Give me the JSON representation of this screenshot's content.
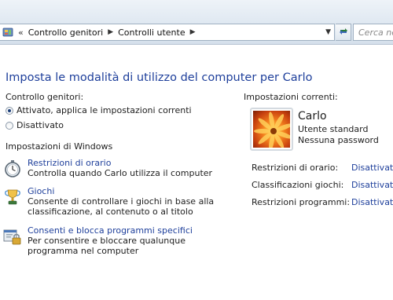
{
  "address_bar": {
    "overflow": "«",
    "crumbs": [
      "Controllo genitori",
      "Controlli utente"
    ],
    "search_placeholder": "Cerca nel"
  },
  "page": {
    "title": "Imposta le modalità di utilizzo del computer per Carlo",
    "parental_control_label": "Controllo genitori:",
    "radio_on": "Attivato, applica le impostazioni correnti",
    "radio_off": "Disattivato",
    "windows_settings_label": "Impostazioni di Windows",
    "tasks": [
      {
        "icon": "stopwatch-icon",
        "link": "Restrizioni di orario",
        "desc": "Controlla quando Carlo utilizza il computer"
      },
      {
        "icon": "trophy-icon",
        "link": "Giochi",
        "desc": "Consente di controllare i giochi in base alla classificazione, al contenuto o al titolo"
      },
      {
        "icon": "program-lock-icon",
        "link": "Consenti e blocca programmi specifici",
        "desc": "Per consentire e bloccare qualunque programma nel computer"
      }
    ]
  },
  "current_settings": {
    "label": "Impostazioni correnti:",
    "user_name": "Carlo",
    "account_type": "Utente standard",
    "password_status": "Nessuna password",
    "rows": [
      {
        "label": "Restrizioni di orario:",
        "value": "Disattivato"
      },
      {
        "label": "Classificazioni giochi:",
        "value": "Disattivato"
      },
      {
        "label": "Restrizioni programmi:",
        "value": "Disattivato"
      }
    ]
  },
  "colors": {
    "link": "#1e3f9b",
    "title": "#1e3f9b",
    "addressbar": "#dfe8f1"
  }
}
